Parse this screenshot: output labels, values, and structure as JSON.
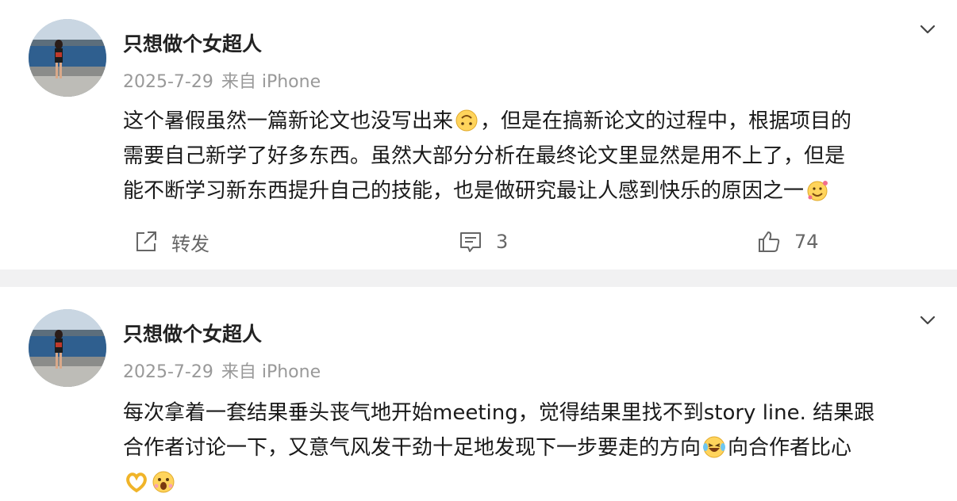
{
  "posts": [
    {
      "username": "只想做个女超人",
      "date": "2025-7-29",
      "source": "来自 iPhone",
      "lines": [
        "这个暑假虽然一篇新论文也没写出来",
        "，但是在搞新论文的过程中，根据项目的",
        "需要自己新学了好多东西。虽然大部分分析在最终论文里显然是用不上了，但是",
        "能不断学习新东西提升自己的技能，也是做研究最让人感到快乐的原因之一"
      ],
      "emojis": [
        "upside-down-face-emoji",
        "smiling-face-with-hearts-emoji"
      ],
      "actions": {
        "repost_label": "转发",
        "comment_count": "3",
        "like_count": "74"
      }
    },
    {
      "username": "只想做个女超人",
      "date": "2025-7-29",
      "source": "来自 iPhone",
      "lines": [
        "每次拿着一套结果垂头丧气地开始meeting，觉得结果里找不到story line. 结果跟",
        "合作者讨论一下，又意气风发干劲十足地发现下一步要走的方向",
        "向合作者比心"
      ],
      "emojis": [
        "laughing-crying-emoji",
        "heart-hands-emoji",
        "surprised-face-emoji"
      ]
    }
  ],
  "colors": {
    "background": "#f1f1f2",
    "card": "#ffffff",
    "meta_text": "#999999",
    "body_text": "#1a1a1a",
    "icon": "#666666"
  }
}
